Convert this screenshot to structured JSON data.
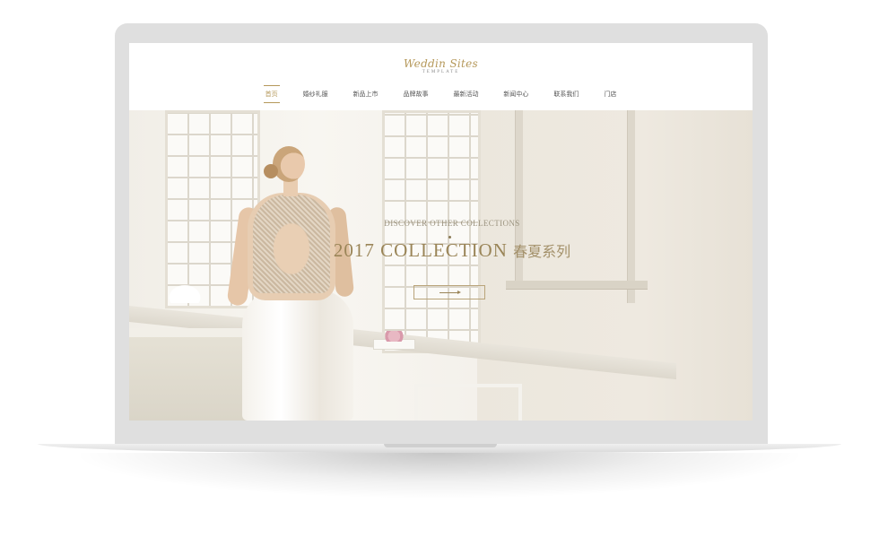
{
  "logo": {
    "script": "Weddin Sites",
    "sub": "TEMPLATE"
  },
  "nav": {
    "items": [
      "首页",
      "婚纱礼服",
      "新品上市",
      "品牌故事",
      "最新活动",
      "新闻中心",
      "联系我们",
      "门店"
    ],
    "active_index": 0
  },
  "hero": {
    "eyebrow": "DISCOVER OTHER COLLECTIONS",
    "year": "2017",
    "title": "COLLECTION",
    "title_cn": "春夏系列"
  },
  "colors": {
    "accent": "#b5985a",
    "heading": "#9a8558",
    "frame": "#dfdfdf"
  },
  "icons": {
    "more_button": "arrow-right-icon"
  }
}
